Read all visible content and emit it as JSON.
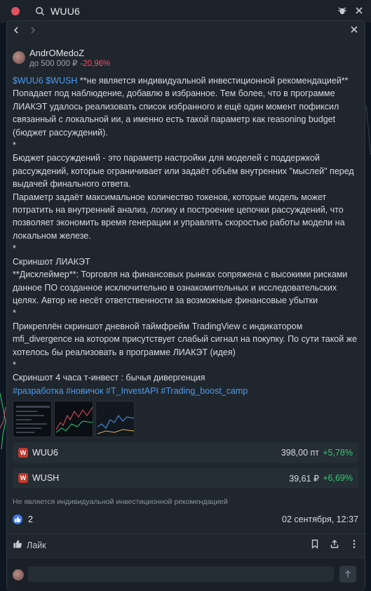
{
  "search": {
    "query": "WUU6"
  },
  "post": {
    "author": "AndrOMedoZ",
    "portfolio_label": "до 500 000 ₽",
    "portfolio_change": "-20,96%",
    "tickers_inline": "$WUU6 $WUSH",
    "text_1": " **не является индивидуальной инвестиционной рекомендацией**\nПопадает под наблюдение, добавлю в избранное. Тем более, что в программе ЛИАКЭТ удалось реализовать список избранного и ещё один момент пофиксил связанный с локальной ии, а именно есть такой параметр как reasoning budget (бюджет рассуждений).\n*\nБюджет рассуждений - это параметр настройки для моделей с поддержкой рассуждений, которые ограничивает или задаёт объём внутренних \"мыслей\" перед выдачей финального ответа.\nПараметр задаёт максимальное количество токенов, которые модель может потратить на внутренний анализ, логику и построение цепочки рассуждений, что позволяет экономить время генерации и управлять скоростью работы модели на локальном железе.\n*\nСкриншот ЛИАКЭТ\n**Дисклеймер**: Торговля на финансовых рынках сопряжена с высокими рисками данное ПО созданное исключительно в ознакомительных и исследовательских целях. Автор не несёт ответственности за возможные финансовые убытки\n*\nПрикреплён скриншот дневной таймфрейм TradingView с индикатором mfi_divergence на котором присутствует слабый сигнал на покупку. По сути такой же хотелось бы реализовать в программе ЛИАКЭТ (идея)\n*\nСкриншот 4 часа т-инвест : бычья дивергенция\n",
    "hashtags": "#разработка #новичок #T_InvestAPI #Trading_boost_camp",
    "disclaimer": "Не является индивидуальной инвестиционной рекомендацией",
    "likes": "2",
    "date": "02 сентября, 12:37",
    "like_label": "Лайк"
  },
  "instruments": [
    {
      "ticker": "WUU6",
      "logo": "W",
      "price": "398,00 пт",
      "change": "+5,78%"
    },
    {
      "ticker": "WUSH",
      "logo": "W",
      "price": "39,61 ₽",
      "change": "+6,69%"
    }
  ],
  "comment": {
    "placeholder": ""
  },
  "colors": {
    "accent": "#4d9cf0",
    "negative": "#f4506a",
    "positive": "#2ecc71",
    "logo": "#c0392b"
  }
}
